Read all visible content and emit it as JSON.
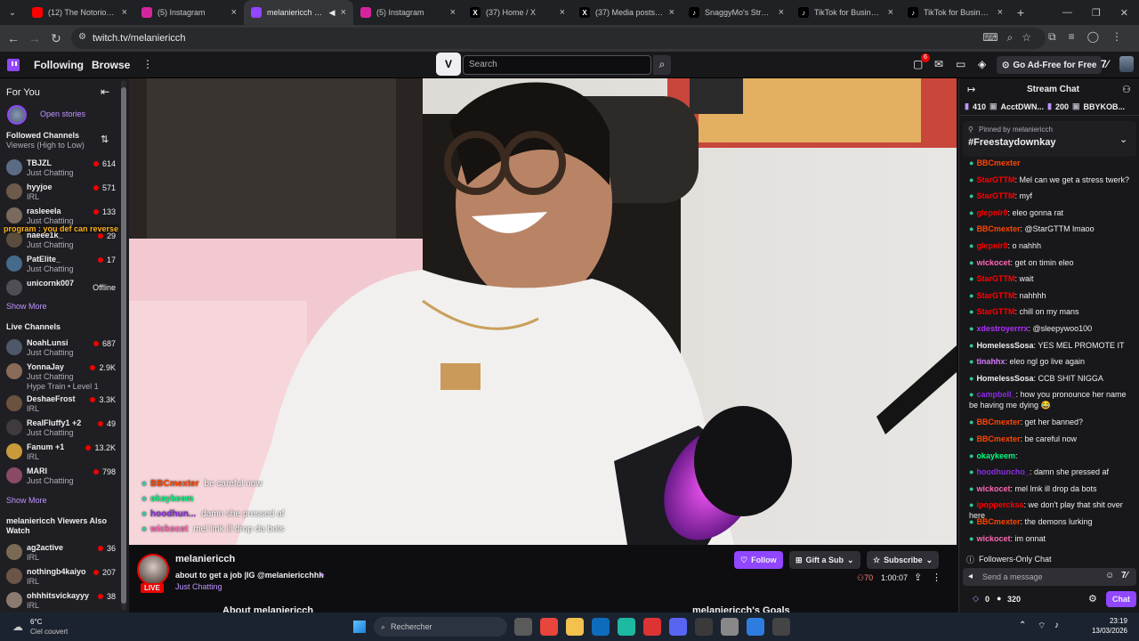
{
  "browser": {
    "tabs": [
      {
        "title": "(12) The Notorious B",
        "fav": "yt",
        "color": "#ff0000"
      },
      {
        "title": "(5) Instagram",
        "fav": "ig",
        "color": "#d6249f"
      },
      {
        "title": "melaniericch - Tw",
        "fav": "tw",
        "color": "#9146ff",
        "active": true
      },
      {
        "title": "(5) Instagram",
        "fav": "ig",
        "color": "#d6249f"
      },
      {
        "title": "(37) Home / X",
        "fav": "x",
        "color": "#000000"
      },
      {
        "title": "(37) Media posts by",
        "fav": "x",
        "color": "#000000"
      },
      {
        "title": "SnaggyMo's Struggle",
        "fav": "tt",
        "color": "#000000"
      },
      {
        "title": "TikTok for Business",
        "fav": "tt",
        "color": "#000000"
      },
      {
        "title": "TikTok for Business",
        "fav": "tt",
        "color": "#000000"
      }
    ],
    "url": "twitch.tv/melaniericch"
  },
  "topnav": {
    "following": "Following",
    "browse": "Browse",
    "search_placeholder": "Search",
    "inbox_badge": "6",
    "go_ad_free": "Go Ad-Free for Free"
  },
  "sidebar": {
    "for_you": "For You",
    "open_stories": "Open stories",
    "followed_title": "Followed Channels",
    "followed_sort": "Viewers (High to Low)",
    "followed": [
      {
        "name": "TBJZL",
        "cat": "Just Chatting",
        "viewers": "614",
        "color": "#5b6b84"
      },
      {
        "name": "hyyjoe",
        "cat": "IRL",
        "viewers": "571",
        "color": "#6d5a4a"
      },
      {
        "name": "rasleeela",
        "cat": "Just Chatting",
        "viewers": "133",
        "color": "#7a6a5e"
      },
      {
        "name": "naeee1k_",
        "cat": "Just Chatting",
        "viewers": "29",
        "color": "#5a4d3e"
      },
      {
        "name": "PatElite_",
        "cat": "Just Chatting",
        "viewers": "17",
        "color": "#456a8a"
      },
      {
        "name": "unicornk007",
        "cat": "",
        "viewers": "Offline",
        "color": "#4e4e55"
      }
    ],
    "overlay_text": "program : you def can reverse",
    "show_more_1": "Show More",
    "live_title": "Live Channels",
    "live": [
      {
        "name": "NoahLunsi",
        "cat": "Just Chatting",
        "viewers": "687",
        "color": "#4e5868"
      },
      {
        "name": "YonnaJay",
        "cat": "Just Chatting",
        "viewers": "2.9K",
        "color": "#8a6b58",
        "extra": "Hype Train • Level 1"
      },
      {
        "name": "DeshaeFrost",
        "cat": "IRL",
        "viewers": "3.3K",
        "color": "#6a5140"
      },
      {
        "name": "RealFluffy1 +2",
        "cat": "Just Chatting",
        "viewers": "49",
        "color": "#3e3a40"
      },
      {
        "name": "Fanum +1",
        "cat": "IRL",
        "viewers": "13.2K",
        "color": "#c89a3a"
      },
      {
        "name": "MARI",
        "cat": "Just Chatting",
        "viewers": "798",
        "color": "#8a4a66"
      }
    ],
    "show_more_2": "Show More",
    "also_watch_title_1": "melaniericch Viewers Also",
    "also_watch_title_2": "Watch",
    "also": [
      {
        "name": "ag2active",
        "cat": "IRL",
        "viewers": "36",
        "color": "#7a6a55"
      },
      {
        "name": "nothingb4kaiyo",
        "cat": "IRL",
        "viewers": "207",
        "color": "#6a5548"
      },
      {
        "name": "ohhhitsvickayyy",
        "cat": "IRL",
        "viewers": "38",
        "color": "#8a7a70"
      }
    ]
  },
  "video_overlay_chat": [
    {
      "user": "BBCmexter",
      "text": "be careful now",
      "color": "#ff4500"
    },
    {
      "user": "okaykeem",
      "text": "",
      "color": "#00ff7f"
    },
    {
      "user": "hoodhun...",
      "text": "damn she pressed af",
      "color": "#8a2be2"
    },
    {
      "user": "wickocet",
      "text": "mel lmk ill drop da bots",
      "color": "#ff69b4"
    }
  ],
  "streamer": {
    "name": "melaniericch",
    "title": "about to get a job |IG @melaniericchhh",
    "category": "Just Chatting",
    "live": "LIVE",
    "follow": "Follow",
    "gift": "Gift a Sub",
    "subscribe": "Subscribe",
    "viewers": "70",
    "uptime": "1:00:07",
    "about": "About melaniericch",
    "goals": "melaniericch's Goals"
  },
  "chat": {
    "title": "Stream Chat",
    "leaderboard": [
      {
        "value": "410"
      },
      {
        "name": "AcctDWN..."
      },
      {
        "value": "200"
      },
      {
        "name": "BBYKOB..."
      }
    ],
    "pinned_by": "Pinned by",
    "pinned_user": "melaniericch",
    "pinned_text": "#Freestaydownkay",
    "messages": [
      {
        "user": "BBCmexter",
        "text": "",
        "color": "#ff4500"
      },
      {
        "user": "StarGTTM",
        "text": ": Mel can we get a stress twerk?",
        "color": "#ff0000"
      },
      {
        "user": "StarGTTM",
        "text": ": myf",
        "color": "#ff0000"
      },
      {
        "user": "glepnir0",
        "text": ": eleo gonna rat",
        "color": "#ff0000"
      },
      {
        "user": "BBCmexter",
        "text": ": @StarGTTM lmaoo",
        "color": "#ff4500"
      },
      {
        "user": "glepnir0",
        "text": ": o nahhh",
        "color": "#ff0000"
      },
      {
        "user": "wickocet",
        "text": ": get on timin eleo",
        "color": "#ff69b4"
      },
      {
        "user": "StarGTTM",
        "text": ": wait",
        "color": "#ff0000"
      },
      {
        "user": "StarGTTM",
        "text": ": nahhhh",
        "color": "#ff0000"
      },
      {
        "user": "StarGTTM",
        "text": ": chill on my mans",
        "color": "#ff0000"
      },
      {
        "user": "xdestroyerrrx",
        "text": ": @sleepywoo100",
        "color": "#b22fff"
      },
      {
        "user": "HomelessSosa",
        "text": ": YES MEL PROMOTE IT",
        "color": "#efeff1"
      },
      {
        "user": "tinahhx",
        "text": ": eleo ngl go live again",
        "color": "#d97aff"
      },
      {
        "user": "HomelessSosa",
        "text": ": CCB SHIT NIGGA",
        "color": "#efeff1"
      },
      {
        "user": "campbell_",
        "text": ": how you pronounce her name be having me dying 😂",
        "color": "#8a2be2"
      },
      {
        "user": "BBCmexter",
        "text": ": get her banned?",
        "color": "#ff4500"
      },
      {
        "user": "BBCmexter",
        "text": ": be careful now",
        "color": "#ff4500"
      },
      {
        "user": "okaykeem",
        "text": ":",
        "color": "#00ff7f"
      },
      {
        "user": "hoodhuncho_",
        "text": ": damn she pressed af",
        "color": "#8a2be2"
      },
      {
        "user": "wickocet",
        "text": ": mel lmk ill drop da bots",
        "color": "#ff69b4"
      },
      {
        "user": "ipopperckss",
        "text": ": we don't play that shit over here",
        "color": "#ff0000"
      },
      {
        "user": "BBCmexter",
        "text": ": the demons lurking",
        "color": "#ff4500"
      },
      {
        "user": "wickocet",
        "text": ": im onnat",
        "color": "#ff69b4"
      }
    ],
    "followers_only": "Followers-Only Chat",
    "send_placeholder": "Send a message",
    "points_a": "0",
    "points_b": "320",
    "chat_button": "Chat"
  },
  "taskbar": {
    "weather_temp": "6°C",
    "weather_desc": "Ciel couvert",
    "search": "Rechercher",
    "time": "23:19",
    "date": "13/03/2026"
  }
}
